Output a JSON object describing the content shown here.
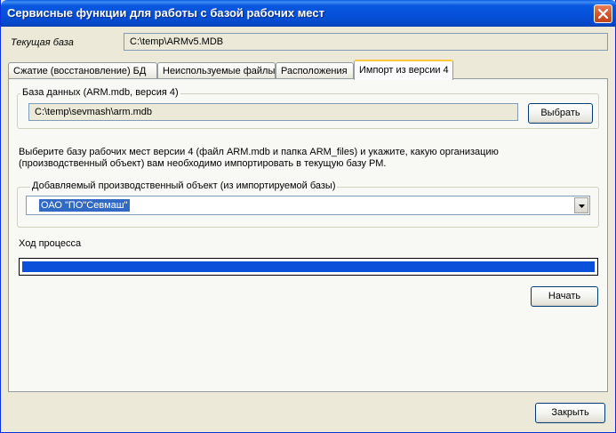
{
  "window": {
    "title": "Сервисные функции для работы с базой рабочих мест"
  },
  "current_db": {
    "label": "Текущая база",
    "value": "C:\\temp\\ARMv5.MDB"
  },
  "tabs": [
    {
      "label": "Сжатие (восстановление) БД",
      "active": false
    },
    {
      "label": "Неиспользуемые файлы",
      "active": false
    },
    {
      "label": "Расположения",
      "active": false
    },
    {
      "label": "Импорт из версии 4",
      "active": true
    }
  ],
  "import_tab": {
    "db_group": {
      "caption": "База данных (ARM.mdb, версия 4)",
      "path": "C:\\temp\\sevmash\\arm.mdb",
      "choose_button": "Выбрать"
    },
    "instructions_line1": "Выберите базу рабочих мест версии 4 (файл ARM.mdb и папка ARM_files) и укажите, какую организацию",
    "instructions_line2": "(производственный объект) вам необходимо импортировать в текущую базу РМ.",
    "object_group": {
      "caption": "Добавляемый производственный объект (из импортируемой базы)",
      "selected": "ОАО \"ПО\"Севмаш\""
    },
    "progress": {
      "label": "Ход процесса",
      "value": 1.0
    },
    "start_button": "Начать"
  },
  "close_button": "Закрыть",
  "colors": {
    "title_bar": "#0550d8",
    "window_bg": "#ece9d8",
    "selection": "#316ac5",
    "progress": "#0a50d8",
    "active_tab_highlight": "#ffc83c"
  },
  "icons": {
    "close": "close-icon",
    "dropdown": "chevron-down-icon"
  }
}
